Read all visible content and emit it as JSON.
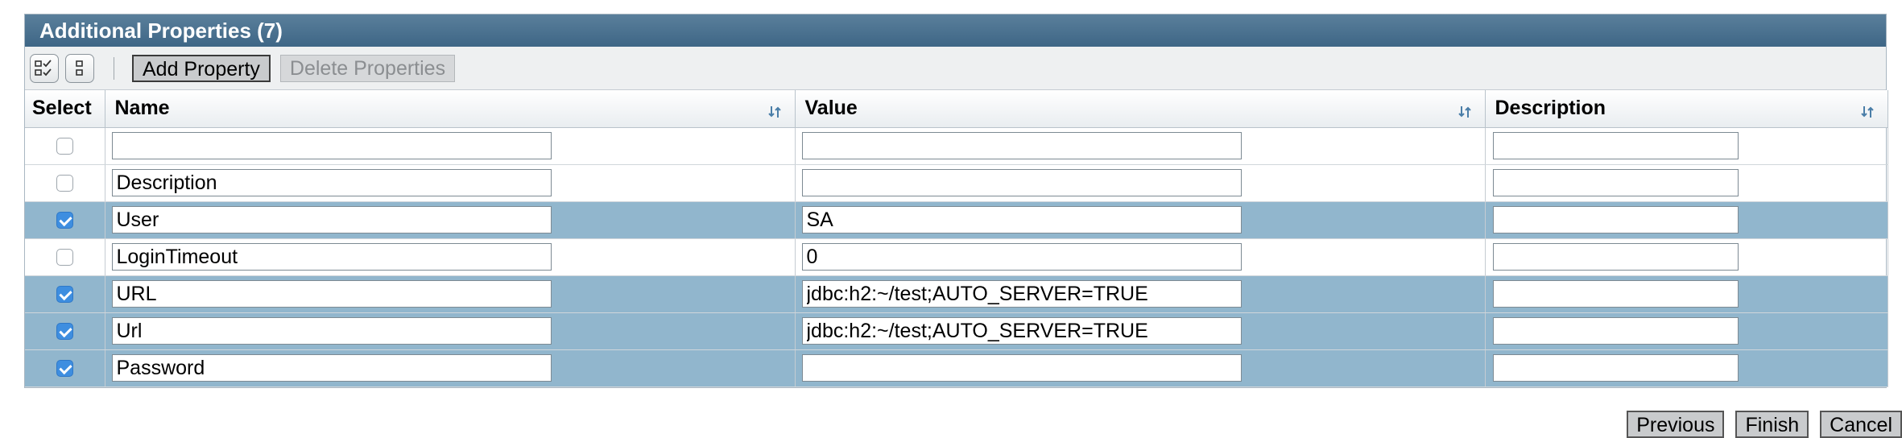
{
  "panel": {
    "title": "Additional Properties (7)"
  },
  "toolbar": {
    "select_all_icon": "select-all-icon",
    "deselect_all_icon": "deselect-all-icon",
    "add_label": "Add Property",
    "delete_label": "Delete Properties"
  },
  "table": {
    "headers": {
      "select": "Select",
      "name": "Name",
      "value": "Value",
      "description": "Description"
    },
    "rows": [
      {
        "selected": false,
        "name": "",
        "value": "",
        "description": ""
      },
      {
        "selected": false,
        "name": "Description",
        "value": "",
        "description": ""
      },
      {
        "selected": true,
        "name": "User",
        "value": "SA",
        "description": ""
      },
      {
        "selected": false,
        "name": "LoginTimeout",
        "value": "0",
        "description": ""
      },
      {
        "selected": true,
        "name": "URL",
        "value": "jdbc:h2:~/test;AUTO_SERVER=TRUE",
        "description": ""
      },
      {
        "selected": true,
        "name": "Url",
        "value": "jdbc:h2:~/test;AUTO_SERVER=TRUE",
        "description": ""
      },
      {
        "selected": true,
        "name": "Password",
        "value": "",
        "description": ""
      }
    ]
  },
  "footer": {
    "previous_label": "Previous",
    "finish_label": "Finish",
    "cancel_label": "Cancel"
  },
  "colors": {
    "title_bar": "#4a7190",
    "selected_row": "#91b6cd",
    "checkbox_on": "#3e8ee0"
  }
}
